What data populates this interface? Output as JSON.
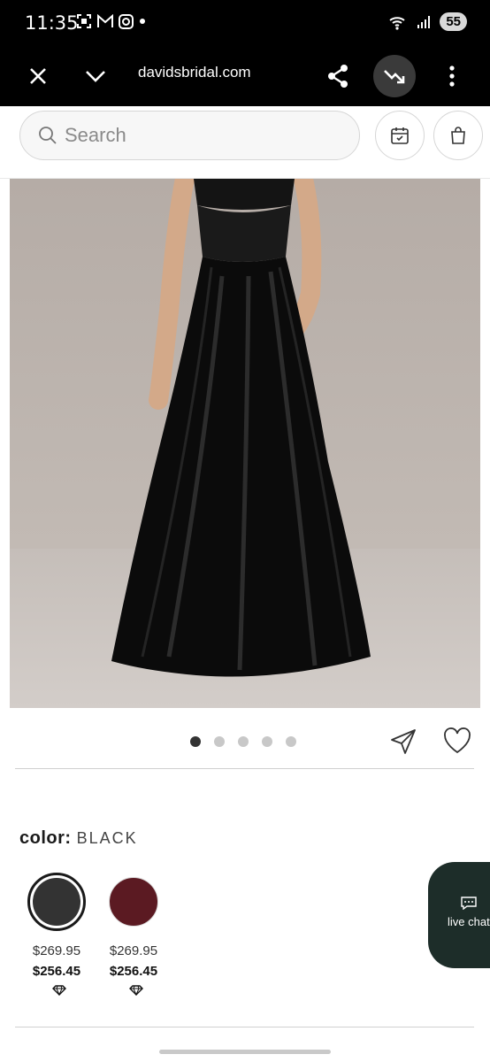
{
  "status": {
    "time": "11:35",
    "battery": "55"
  },
  "browser": {
    "url": "davidsbridal.com"
  },
  "search": {
    "placeholder": "Search"
  },
  "gallery": {
    "dot_count": 5,
    "active_index": 0
  },
  "color": {
    "label": "color:",
    "value": "BLACK"
  },
  "swatches": [
    {
      "color": "#333333",
      "price": "$269.95",
      "sale_price": "$256.45",
      "selected": true
    },
    {
      "color": "#5b1a22",
      "price": "$269.95",
      "sale_price": "$256.45",
      "selected": false
    }
  ],
  "chat": {
    "label": "live chat"
  },
  "colors": {
    "dress": "#0b0b0b",
    "chat_bg": "#1d2d29"
  }
}
